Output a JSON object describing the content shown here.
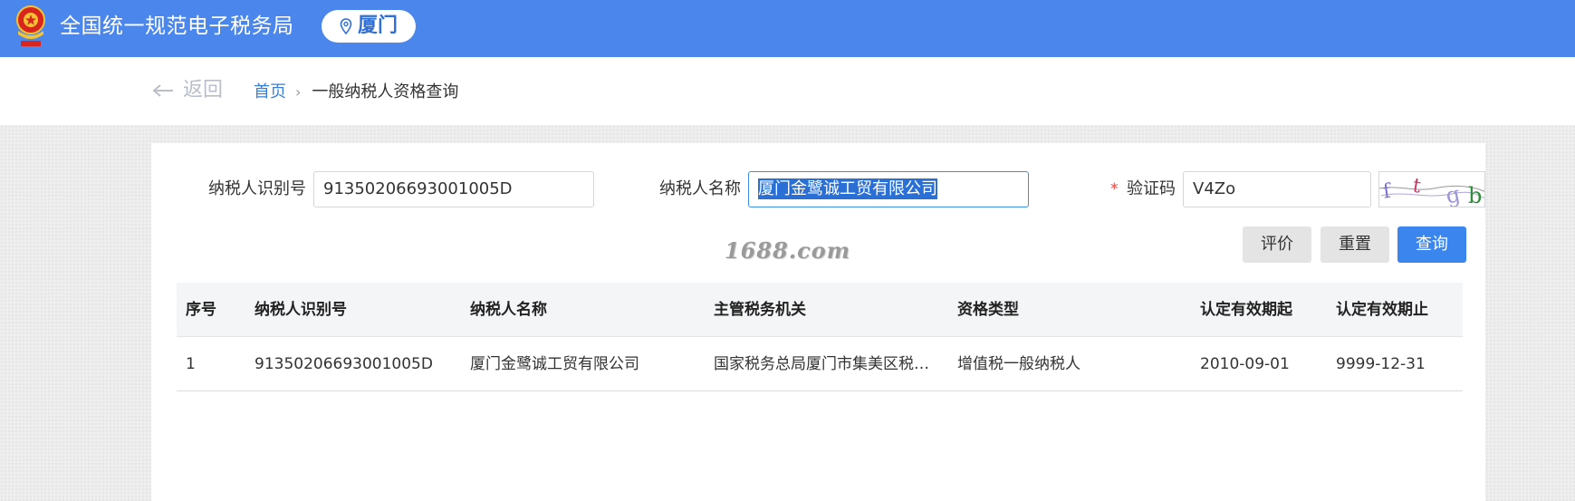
{
  "header": {
    "emblem_name": "national-tax-emblem",
    "title": "全国统一规范电子税务局",
    "city": "厦门",
    "colors": {
      "bar": "#4a86ec",
      "city_text": "#2f6fd8"
    }
  },
  "nav": {
    "back_label": "返回",
    "breadcrumb_home": "首页",
    "breadcrumb_separator": "›",
    "breadcrumb_current": "一般纳税人资格查询"
  },
  "form": {
    "taxpayer_id_label": "纳税人识别号",
    "taxpayer_id_value": "91350206693001005D",
    "taxpayer_name_label": "纳税人名称",
    "taxpayer_name_value": "厦门金鹭诚工贸有限公司",
    "captcha_label": "验证码",
    "captcha_required_mark": "*",
    "captcha_value": "V4Zo"
  },
  "watermark": "1688.com",
  "buttons": {
    "evaluate": "评价",
    "reset": "重置",
    "query": "查询",
    "primary_color": "#3a86ee"
  },
  "table": {
    "headers": [
      "序号",
      "纳税人识别号",
      "纳税人名称",
      "主管税务机关",
      "资格类型",
      "认定有效期起",
      "认定有效期止"
    ],
    "rows": [
      [
        "1",
        "91350206693001005D",
        "厦门金鹭诚工贸有限公司",
        "国家税务总局厦门市集美区税…",
        "增值税一般纳税人",
        "2010-09-01",
        "9999-12-31"
      ]
    ]
  }
}
